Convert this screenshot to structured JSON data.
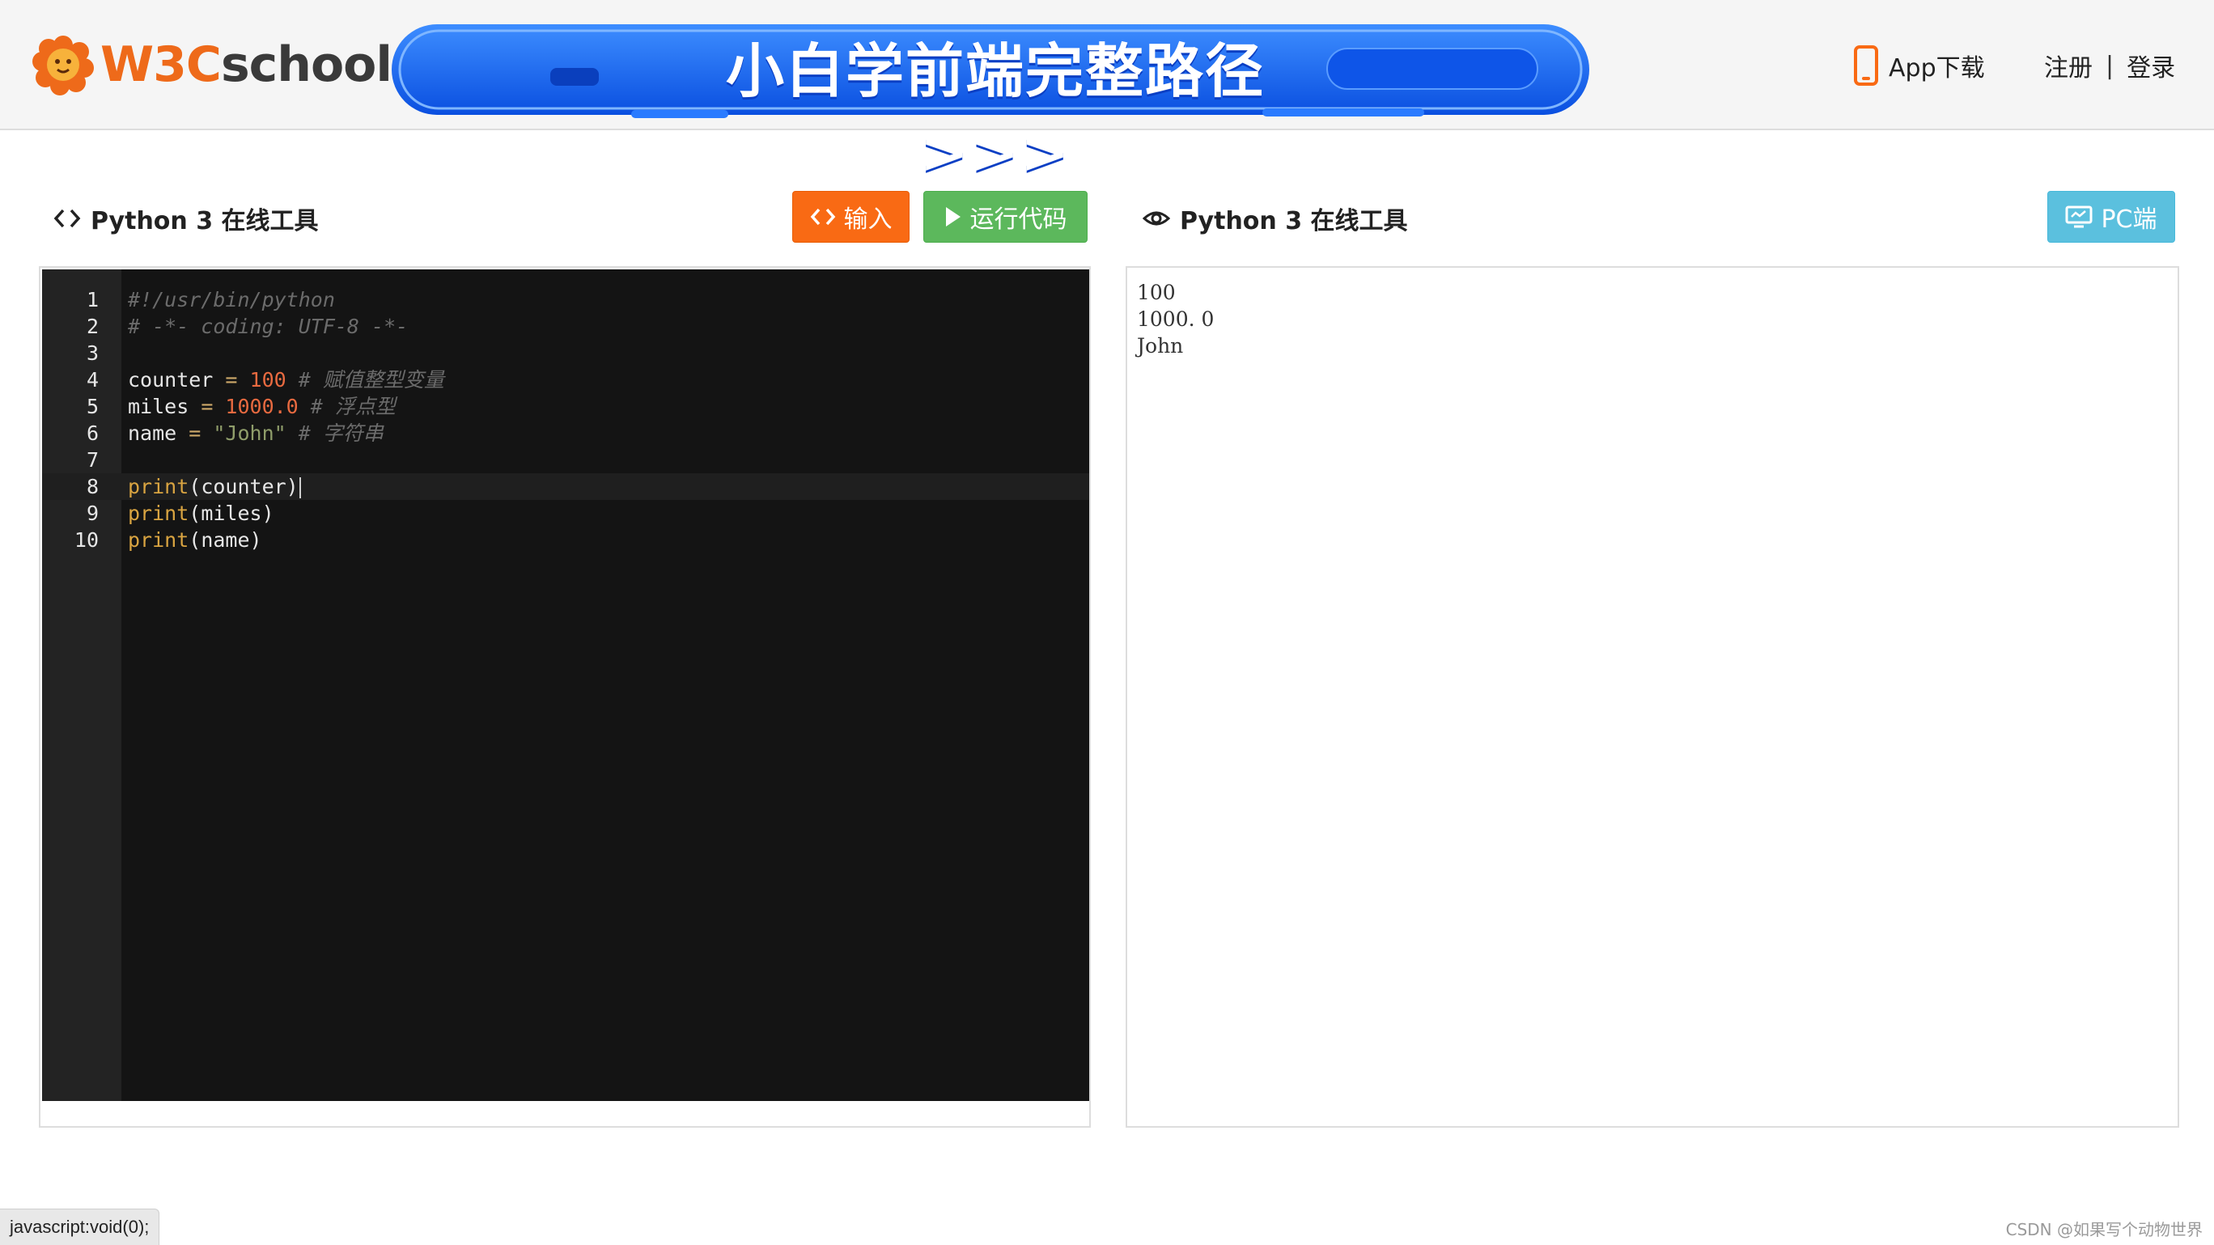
{
  "header": {
    "logo_w3": "W3C",
    "logo_school": "school",
    "banner_text": "小白学前端完整路径>>>",
    "app_download": "App下载",
    "register": "注册",
    "separator": "|",
    "login": "登录"
  },
  "editor_panel": {
    "title": "Python 3 在线工具",
    "input_button": "输入",
    "run_button": "运行代码"
  },
  "output_panel": {
    "title": "Python 3 在线工具",
    "pc_button": "PC端",
    "lines": [
      "100",
      "1000. 0",
      "John"
    ]
  },
  "code": {
    "active_line": 8,
    "line_numbers": [
      "1",
      "2",
      "3",
      "4",
      "5",
      "6",
      "7",
      "8",
      "9",
      "10"
    ],
    "l1": "#!/usr/bin/python",
    "l2": "# -*- coding: UTF-8 -*-",
    "l4_var": "counter",
    "l4_op": " = ",
    "l4_val": "100",
    "l4_cmt": " # 赋值整型变量",
    "l5_var": "miles",
    "l5_op": " = ",
    "l5_val": "1000.0",
    "l5_cmt": " # 浮点型",
    "l6_var": "name",
    "l6_op": " = ",
    "l6_val": "\"John\"",
    "l6_cmt": " # 字符串",
    "l8_fn": "print",
    "l8_arg": "(counter)",
    "l9_fn": "print",
    "l9_arg": "(miles)",
    "l10_fn": "print",
    "l10_arg": "(name)"
  },
  "status_bar": "javascript:void(0);",
  "watermark": "CSDN @如果写个动物世界",
  "colors": {
    "brand_orange": "#ee6a1a",
    "input_button": "#f96a14",
    "run_button": "#5cb85c",
    "pc_button": "#5bc0de",
    "banner_blue": "#1a6cf5",
    "editor_bg": "#141414"
  },
  "icons": {
    "logo": "lion-logo-icon",
    "phone": "phone-icon",
    "code": "code-brackets-icon",
    "play": "play-icon",
    "eye": "eye-icon",
    "monitor": "monitor-icon"
  }
}
